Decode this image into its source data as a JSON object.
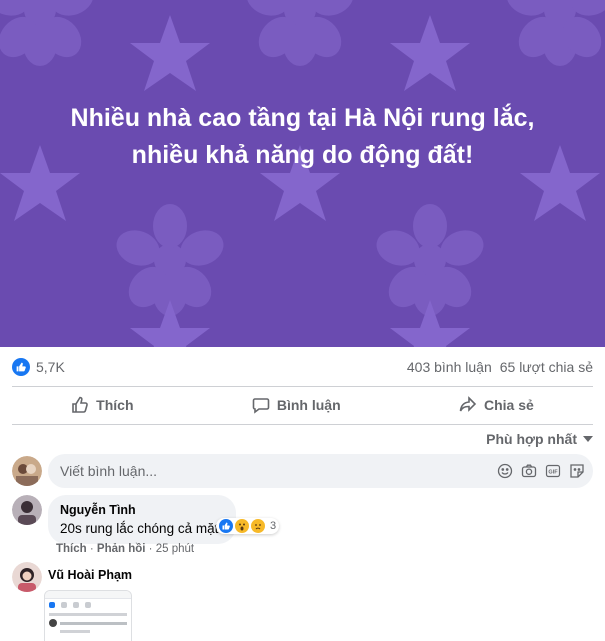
{
  "post": {
    "banner_text_line1": "Nhiều nhà cao tầng tại Hà Nội rung lắc,",
    "banner_text_line2": "nhiều khả năng do động đất!",
    "banner_color": "#6a4bb0"
  },
  "stats": {
    "reaction_count": "5,7K",
    "comment_count": "403 bình luận",
    "share_count": "65 lượt chia sẻ"
  },
  "actions": {
    "like": "Thích",
    "comment": "Bình luận",
    "share": "Chia sẻ"
  },
  "sort": {
    "label": "Phù hợp nhất"
  },
  "composer": {
    "placeholder": "Viết bình luận..."
  },
  "comments": [
    {
      "name": "Nguyễn Tình",
      "text": "20s rung lắc chóng cả mặt",
      "reaction_count": "3",
      "like_label": "Thích",
      "reply_label": "Phản hồi",
      "time": "25 phút"
    },
    {
      "name": "Vũ Hoài Phạm"
    }
  ],
  "colors": {
    "accent": "#1877f2",
    "muted": "#65676b"
  }
}
